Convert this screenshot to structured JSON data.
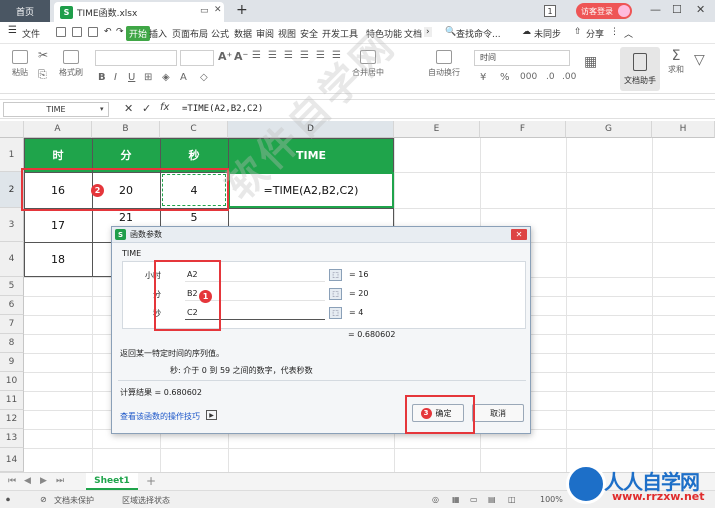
{
  "titlebar": {
    "home_tab": "首页",
    "file_tab": "TIME函数.xlsx",
    "file_icon": "S",
    "new_tab": "+",
    "badge": "1",
    "login": "访客登录"
  },
  "menu": {
    "file": "文件",
    "items": [
      "开始",
      "插入",
      "页面布局",
      "公式",
      "数据",
      "审阅",
      "视图",
      "安全",
      "开发工具",
      "特色功能",
      "文档"
    ],
    "search": "查找命令...",
    "unsync": "未同步",
    "share": "分享"
  },
  "ribbon": {
    "paste": "粘贴",
    "format_painter": "格式刷",
    "merge_center": "合并居中",
    "auto_wrap": "自动换行",
    "number_format": "时间",
    "doc_helper": "文档助手",
    "sum": "求和"
  },
  "formula_bar": {
    "name_box": "TIME",
    "cancel": "✕",
    "confirm": "✓",
    "fx": "fx",
    "formula": "=TIME(A2,B2,C2)"
  },
  "grid": {
    "columns": [
      "A",
      "B",
      "C",
      "D",
      "E",
      "F",
      "G",
      "H"
    ],
    "rows": [
      "1",
      "2",
      "3",
      "4",
      "5",
      "6",
      "7",
      "8",
      "9",
      "10",
      "11",
      "12",
      "13",
      "14"
    ],
    "headers": {
      "a": "时",
      "b": "分",
      "c": "秒",
      "d": "TIME"
    },
    "row2": {
      "a": "16",
      "b": "20",
      "c": "4",
      "d": "=TIME(A2,B2,C2)"
    },
    "row3": {
      "a": "17",
      "b": "21",
      "c": "5"
    },
    "row4": {
      "a": "18"
    }
  },
  "dialog": {
    "title": "函数参数",
    "function_name": "TIME",
    "args": [
      {
        "label": "小时",
        "ref": "A2",
        "value": "= 16"
      },
      {
        "label": "分",
        "ref": "B2",
        "value": "= 20"
      },
      {
        "label": "秒",
        "ref": "C2",
        "value": "= 4"
      }
    ],
    "result_inline": "= 0.680602",
    "description": "返回某一特定时间的序列值。",
    "arg_help": "秒:  介于 0 到 59 之间的数字，代表秒数",
    "calc_result": "计算结果 =  0.680602",
    "help_link": "查看该函数的操作技巧",
    "ok": "确定",
    "cancel": "取消"
  },
  "annotations": {
    "one": "1",
    "two": "2",
    "three": "3"
  },
  "sheets": {
    "tab": "Sheet1"
  },
  "status": {
    "unprotected": "文档未保护",
    "region_state": "区域选择状态",
    "zoom": "100%"
  },
  "watermark": "软件自学网",
  "logo": {
    "brand": "人人自学网",
    "url": "www.rrzxw.net"
  },
  "colors": {
    "header_green": "#1fa44b",
    "annotation_red": "#e5363b",
    "link_blue": "#1a55c9"
  }
}
